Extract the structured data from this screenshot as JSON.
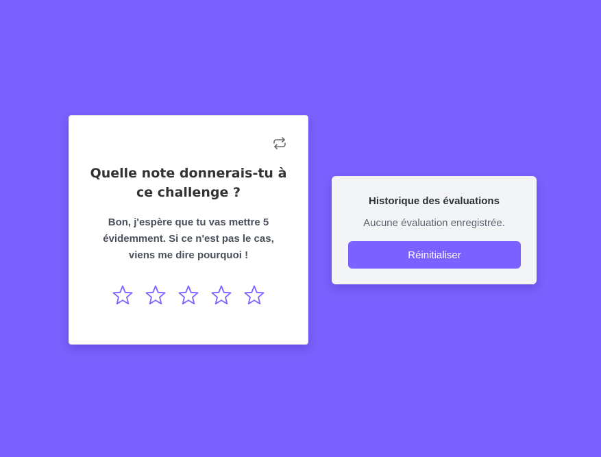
{
  "colors": {
    "background": "#7b61ff",
    "accent": "#7b61ff",
    "card": "#ffffff",
    "history_card": "#f3f4f6",
    "star_outline": "#7b61ff"
  },
  "rating_card": {
    "refresh_icon": "repeat-icon",
    "title": "Quelle note donnerais-tu à ce challenge ?",
    "text": "Bon, j'espère que tu vas mettre 5 évidemment. Si ce n'est pas le cas, viens me dire pourquoi !",
    "stars": {
      "count": 5,
      "selected": 0,
      "icon": "star-outline-icon"
    }
  },
  "history": {
    "title": "Historique des évaluations",
    "empty_text": "Aucune évaluation enregistrée.",
    "reset_label": "Réinitialiser"
  }
}
